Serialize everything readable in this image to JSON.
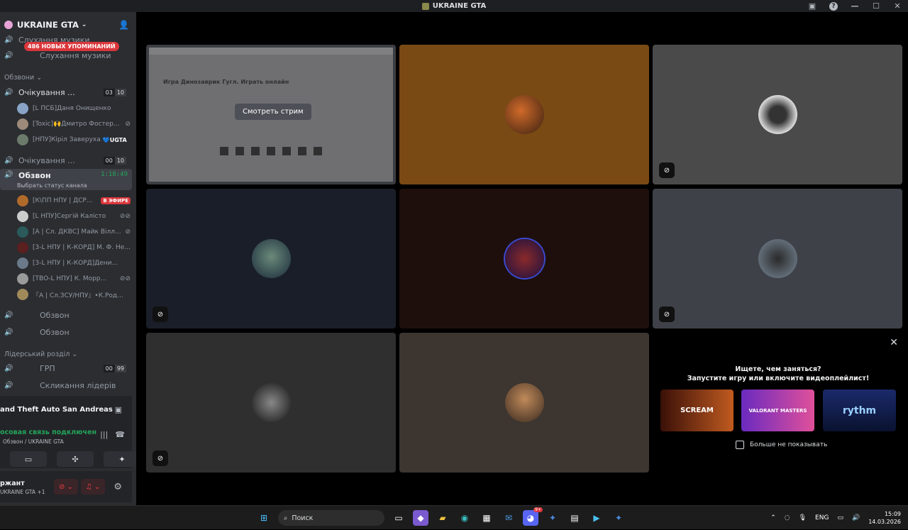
{
  "window": {
    "title": "UKRAINE GTA"
  },
  "server": {
    "name": "UKRAINE GTA"
  },
  "mentions": {
    "label": "486 НОВЫХ УПОМИНАНИЙ"
  },
  "channels": {
    "top1": "Слухання музики",
    "top2": "Слухання музики",
    "category1": "Обзвони",
    "waiting1": {
      "name": "Очікування ...",
      "count1": "03",
      "count2": "10"
    },
    "waiting2": {
      "name": "Очікування ...",
      "count1": "00",
      "count2": "10"
    },
    "active": {
      "name": "Обзвон",
      "timer": "1:18:49",
      "status": "Выбрать статус канала"
    },
    "obzvon2": "Обзвон",
    "obzvon3": "Обзвон",
    "category2": "Лідерський розділ",
    "grp": {
      "name": "ГРП",
      "count1": "00",
      "count2": "99"
    },
    "leaders": "Скликання лідерів"
  },
  "waiting_users": [
    {
      "name": "[L ПСБ]Даня Онищенко"
    },
    {
      "name": "[Toxic]🙌Дмитро Фостер..."
    },
    {
      "name": "[НПУ]Кіріл Заверуха",
      "badge": "💙UGTA"
    }
  ],
  "active_users": [
    {
      "name": "[К\\ПП НПУ | ДСР...",
      "badge": "В ЭФИРЕ"
    },
    {
      "name": "[L НПУ]Сергій Калісто"
    },
    {
      "name": "[A | Сл. ДКВС] Майк Вілл..."
    },
    {
      "name": "[3-L НПУ | К-КОРД] М. Ф. Не..."
    },
    {
      "name": "[3-L НПУ | К-КОРД]Дени..."
    },
    {
      "name": "[ТВО-L НПУ] К. Морр..."
    },
    {
      "name": "『A | Сл.ЗСУ/НПУ』•К.Род..."
    }
  ],
  "activity": {
    "game": "and Theft Auto San Andreas"
  },
  "voice": {
    "status": "осовая связь подключен",
    "location": "Обзвон / UKRAINE GTA"
  },
  "user": {
    "name": "ржант",
    "sub": "UKRAINE GTA +1"
  },
  "stream": {
    "watch_label": "Смотреть стрим",
    "page_title": "Игра Динозаврик Гугл. Играть онлайн"
  },
  "promo": {
    "line1": "Ищете, чем заняться?",
    "line2": "Запустите игру или включите видеоплейлист!",
    "cards": [
      "SCREAM",
      "VALORANT MASTERS",
      "rythm"
    ],
    "dont_show": "Больше не показывать"
  },
  "taskbar": {
    "search": "Поиск",
    "lang": "ENG",
    "time": "15:09",
    "date": "14.03.2026",
    "badge": "9+"
  },
  "colors": {
    "accent_green": "#23a55a",
    "accent_red": "#da373c",
    "sidebar_bg": "#2b2d31"
  }
}
